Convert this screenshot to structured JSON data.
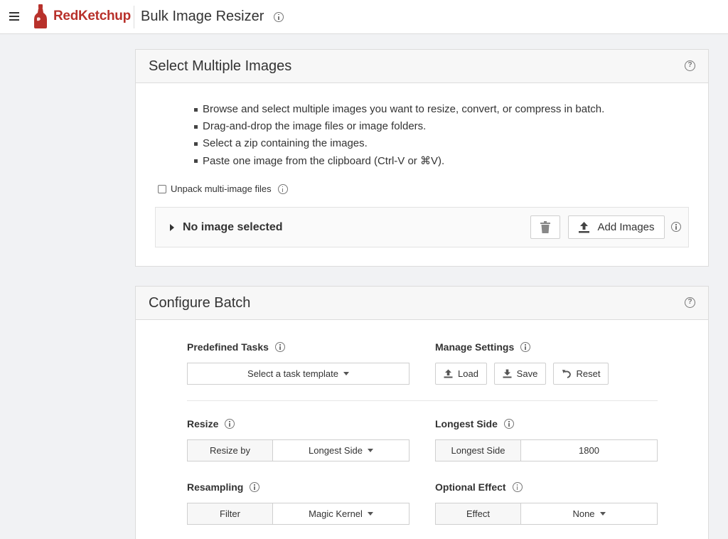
{
  "header": {
    "brand": "RedKetchup",
    "title": "Bulk Image Resizer",
    "menu_icon": "hamburger-icon",
    "brand_color": "#b8312b"
  },
  "select_panel": {
    "title": "Select Multiple Images",
    "bullets": [
      "Browse and select multiple images you want to resize, convert, or compress in batch.",
      "Drag-and-drop the image files or image folders.",
      "Select a zip containing the images.",
      "Paste one image from the clipboard (Ctrl-V or ⌘V)."
    ],
    "unpack_label": "Unpack multi-image files",
    "unpack_checked": false,
    "no_image_label": "No image selected",
    "add_images_label": "Add Images"
  },
  "config_panel": {
    "title": "Configure Batch",
    "predefined_tasks": {
      "label": "Predefined Tasks",
      "value": "Select a task template"
    },
    "manage_settings": {
      "label": "Manage Settings",
      "load": "Load",
      "save": "Save",
      "reset": "Reset"
    },
    "resize": {
      "label": "Resize",
      "field_label": "Resize by",
      "value": "Longest Side"
    },
    "longest_side": {
      "label": "Longest Side",
      "field_label": "Longest Side",
      "value": "1800"
    },
    "resampling": {
      "label": "Resampling",
      "field_label": "Filter",
      "value": "Magic Kernel"
    },
    "optional_effect": {
      "label": "Optional Effect",
      "field_label": "Effect",
      "value": "None"
    }
  }
}
